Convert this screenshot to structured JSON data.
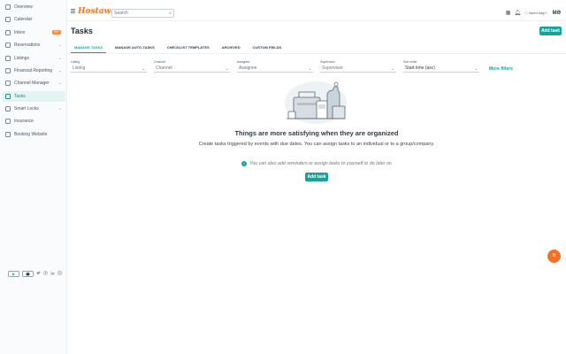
{
  "sidebar": {
    "items": [
      {
        "label": "Overview"
      },
      {
        "label": "Calendar"
      },
      {
        "label": "Inbox",
        "badge": "99+"
      },
      {
        "label": "Reservations"
      },
      {
        "label": "Listings"
      },
      {
        "label": "Financial Reporting"
      },
      {
        "label": "Channel Manager"
      },
      {
        "label": "Tasks"
      },
      {
        "label": "Smart Locks"
      },
      {
        "label": "Insurance"
      },
      {
        "label": "Booking Website"
      }
    ],
    "stores": {
      "google_play": "▶",
      "app_store": ""
    }
  },
  "topbar": {
    "logo": "Hostaway",
    "search_placeholder": "Search",
    "help": "Need help?",
    "avatar": "MƏ"
  },
  "page": {
    "title": "Tasks",
    "add_task": "Add task"
  },
  "tabs": [
    {
      "label": "MANAGE TASKS"
    },
    {
      "label": "MANAGE AUTO-TASKS"
    },
    {
      "label": "CHECKLIST TEMPLATES"
    },
    {
      "label": "ARCHIVED"
    },
    {
      "label": "CUSTOM FIELDS"
    }
  ],
  "filters": [
    {
      "label": "Listing",
      "value": "Listing"
    },
    {
      "label": "Channel",
      "value": "Channel"
    },
    {
      "label": "Assignee",
      "value": "Assignee"
    },
    {
      "label": "Supervisor",
      "value": "Supervisor"
    },
    {
      "label": "Sort order",
      "value": "Start time (asc)"
    }
  ],
  "more_filters": "More filters",
  "empty_state": {
    "title": "Things are more satisfying when they are organized",
    "subtitle": "Create tasks triggered by events with due dates. You can assign tasks to an individual or to a group/company.",
    "tip": "You can also add reminders or assign tasks to yourself to do later on",
    "add_task": "Add task"
  },
  "fab": "H",
  "colors": {
    "accent": "#17a39c",
    "brand": "#f07a28",
    "fab": "#f0712a",
    "badge": "#f08a3c"
  }
}
